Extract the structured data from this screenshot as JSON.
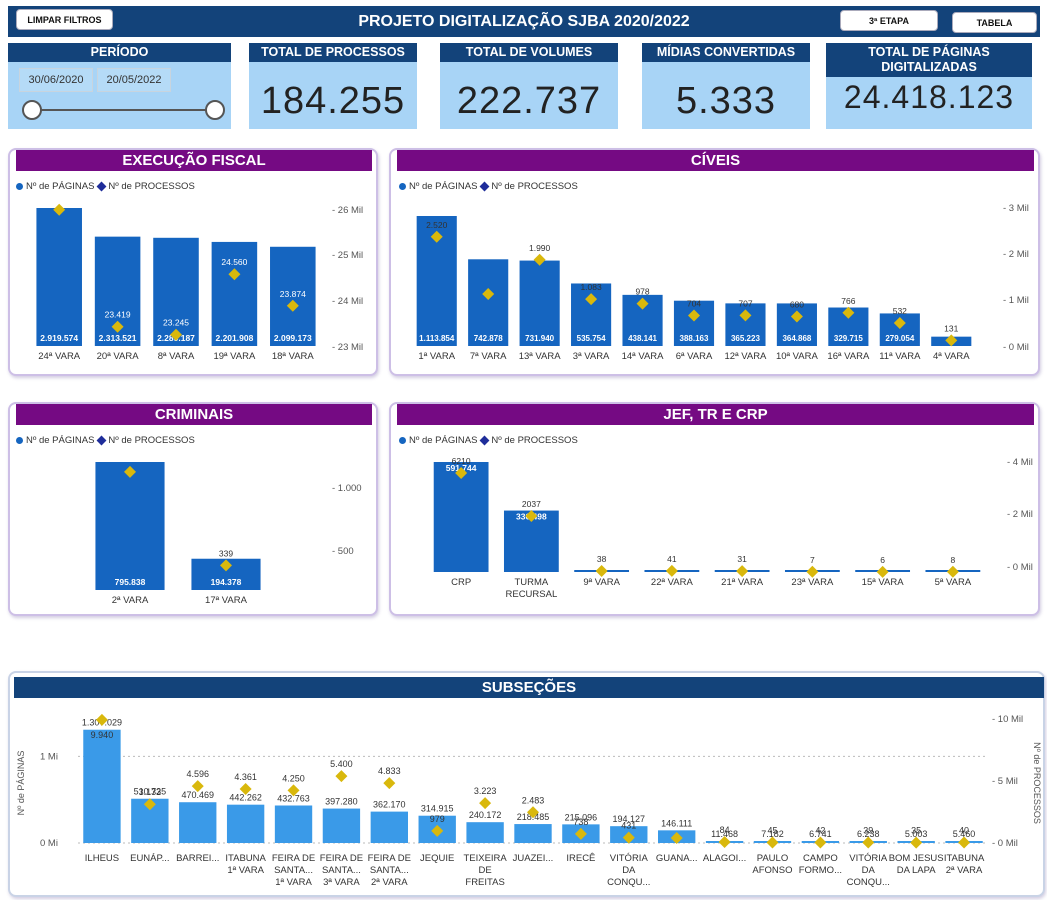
{
  "header": {
    "title": "PROJETO DIGITALIZAÇÃO SJBA 2020/2022",
    "clear_filters": "LIMPAR FILTROS",
    "stage_button": "3ª ETAPA",
    "table_button": "TABELA"
  },
  "period": {
    "label": "PERÍODO",
    "start_date": "30/06/2020",
    "end_date": "20/05/2022"
  },
  "kpis": [
    {
      "label": "TOTAL DE PROCESSOS",
      "value": "184.255"
    },
    {
      "label": "TOTAL DE VOLUMES",
      "value": "222.737"
    },
    {
      "label": "MÍDIAS CONVERTIDAS",
      "value": "5.333"
    },
    {
      "label": "TOTAL DE PÁGINAS DIGITALIZADAS",
      "value": "24.418.123"
    }
  ],
  "legend": {
    "pages": "Nº de PÁGINAS",
    "processes": "Nº de PROCESSOS"
  },
  "colors": {
    "navy": "#13437a",
    "purple": "#750a83",
    "bar": "#1565c0",
    "bar_light": "#3a9ae8",
    "marker": "#d9b80c",
    "kpi_bg": "#a8d4f6"
  },
  "chart_data": [
    {
      "id": "execucao_fiscal",
      "title": "EXECUÇÃO FISCAL",
      "type": "bar",
      "categories": [
        "24ª VARA",
        "20ª VARA",
        "8ª VARA",
        "19ª VARA",
        "18ª VARA"
      ],
      "series": [
        {
          "name": "Nº de PÁGINAS",
          "values": [
            2919574,
            2313521,
            2289187,
            2201908,
            2099173
          ],
          "labels": [
            "2.919.574",
            "2.313.521",
            "2.289.187",
            "2.201.908",
            "2.099.173"
          ]
        },
        {
          "name": "Nº de PROCESSOS",
          "values": [
            25962,
            23419,
            23245,
            24560,
            23874
          ],
          "labels": [
            "25.962",
            "23.419",
            "23.245",
            "24.560",
            "23.874"
          ]
        }
      ],
      "y2_ticks": [
        "26 Mil",
        "25 Mil",
        "24 Mil",
        "23 Mil"
      ],
      "y2lim": [
        23000,
        26000
      ]
    },
    {
      "id": "civeis",
      "title": "CÍVEIS",
      "type": "bar",
      "categories": [
        "1ª VARA",
        "7ª VARA",
        "13ª VARA",
        "3ª VARA",
        "14ª VARA",
        "6ª VARA",
        "12ª VARA",
        "10ª VARA",
        "16ª VARA",
        "11ª VARA",
        "4ª VARA"
      ],
      "series": [
        {
          "name": "Nº de PÁGINAS",
          "values": [
            1113854,
            742878,
            731940,
            535754,
            438141,
            388163,
            365223,
            364868,
            329715,
            279054,
            80000
          ],
          "labels": [
            "1.113.854",
            "742.878",
            "731.940",
            "535.754",
            "438.141",
            "388.163",
            "365.223",
            "364.868",
            "329.715",
            "279.054",
            ""
          ]
        },
        {
          "name": "Nº de PROCESSOS",
          "values": [
            2520,
            1200,
            1990,
            1083,
            978,
            704,
            707,
            680,
            766,
            532,
            131
          ],
          "labels": [
            "2.520",
            "",
            "1.990",
            "1.083",
            "978",
            "704",
            "707",
            "680",
            "766",
            "532",
            "131"
          ]
        }
      ],
      "y2_ticks": [
        "3 Mil",
        "2 Mil",
        "1 Mil",
        "0 Mil"
      ],
      "y2lim": [
        0,
        3000
      ]
    },
    {
      "id": "criminais",
      "title": "CRIMINAIS",
      "type": "bar",
      "categories": [
        "2ª VARA",
        "17ª VARA"
      ],
      "series": [
        {
          "name": "Nº de PÁGINAS",
          "values": [
            795838,
            194378
          ],
          "labels": [
            "795.838",
            "194.378"
          ]
        },
        {
          "name": "Nº de PROCESSOS",
          "values": [
            1200,
            250
          ],
          "labels": [
            "",
            "339"
          ]
        }
      ],
      "y2_ticks": [
        "1.000",
        "500"
      ],
      "y2lim": [
        0,
        1300
      ]
    },
    {
      "id": "jef",
      "title": "JEF, TR E CRP",
      "type": "bar",
      "categories": [
        "CRP",
        "TURMA RECURSAL",
        "9ª VARA",
        "22ª VARA",
        "21ª VARA",
        "23ª VARA",
        "15ª VARA",
        "5ª VARA"
      ],
      "series": [
        {
          "name": "Nº de PÁGINAS",
          "values": [
            591744,
            330498,
            7000,
            5000,
            5000,
            2000,
            2000,
            2000
          ],
          "labels": [
            "591.744",
            "330.498",
            "",
            "",
            "",
            "",
            "",
            ""
          ]
        },
        {
          "name": "Nº de PROCESSOS",
          "values": [
            3600,
            2037,
            38,
            41,
            31,
            7,
            6,
            8
          ],
          "labels": [
            "6210",
            "2037",
            "38",
            "41",
            "31",
            "7",
            "6",
            "8"
          ]
        }
      ],
      "y2_ticks": [
        "4 Mil",
        "2 Mil",
        "0 Mil"
      ],
      "y2lim": [
        0,
        4000
      ]
    },
    {
      "id": "subsecoes",
      "title": "SUBSEÇÕES",
      "type": "bar",
      "ylabel": "Nº de PÁGINAS",
      "y2label": "Nº de PROCESSOS",
      "categories": [
        "ILHEUS",
        "EUNÁP...",
        "BARREI...",
        "ITABUNA 1ª VARA",
        "FEIRA DE SANTA... 1ª VARA",
        "FEIRA DE SANTA... 3ª VARA",
        "FEIRA DE SANTA... 2ª VARA",
        "JEQUIE",
        "TEIXEIRA DE FREITAS",
        "JUAZEI...",
        "IRECÊ",
        "VITÓRIA DA CONQU...",
        "GUANA...",
        "ALAGOI...",
        "PAULO AFONSO",
        "CAMPO FORMO...",
        "VITÓRIA DA CONQU...",
        "BOM JESUS DA LAPA",
        "ITABUNA 2ª VARA"
      ],
      "series": [
        {
          "name": "Nº de PÁGINAS",
          "values": [
            1307029,
            510735,
            470469,
            442262,
            432763,
            397280,
            362170,
            314915,
            240172,
            218485,
            215096,
            194127,
            146111,
            11468,
            7182,
            6741,
            6238,
            5003,
            5460
          ],
          "labels": [
            "1.307.029",
            "510.735",
            "470.469",
            "442.262",
            "432.763",
            "397.280",
            "362.170",
            "314.915",
            "240.172",
            "218.485",
            "215.096",
            "194.127",
            "146.111",
            "11.468",
            "7.182",
            "6.741",
            "6.238",
            "5.003",
            "5.460"
          ]
        },
        {
          "name": "Nº de PROCESSOS",
          "values": [
            9940,
            3132,
            4596,
            4361,
            4250,
            5400,
            4833,
            979,
            3223,
            2483,
            738,
            431,
            400,
            84,
            45,
            42,
            39,
            35,
            40
          ],
          "labels": [
            "9.940",
            "3.132",
            "4.596",
            "4.361",
            "4.250",
            "5.400",
            "4.833",
            "979",
            "3.223",
            "2.483",
            "738",
            "431",
            "",
            "84",
            "45",
            "42",
            "39",
            "35",
            "40"
          ]
        }
      ],
      "y_ticks": [
        "1 Mi",
        "0 Mi"
      ],
      "y2_ticks": [
        "10 Mil",
        "5 Mil",
        "0 Mil"
      ],
      "ylim": [
        0,
        1500000
      ],
      "y2lim": [
        0,
        10500
      ]
    }
  ]
}
